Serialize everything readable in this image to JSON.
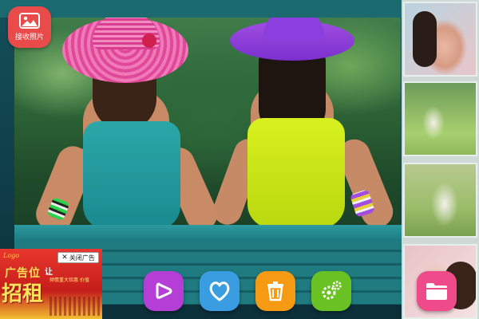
{
  "app": {
    "receive_photo_label": "接收照片",
    "icons": {
      "receive": "image-icon",
      "play": "play-icon",
      "favorite": "heart-icon",
      "delete": "trash-icon",
      "settings": "gear-icon",
      "folder": "folder-icon"
    },
    "colors": {
      "receive": "#e94a4a",
      "play": "#b43ed6",
      "favorite": "#3a9de2",
      "delete": "#f59a12",
      "settings": "#6ac123",
      "folder": "#ef4a8a"
    }
  },
  "ad": {
    "logo": "Logo",
    "close_label": "关闭广告",
    "headline_small": "广告位",
    "headline_big": "招租",
    "decor": "让",
    "subline": "倾情重大钜惠 价值"
  }
}
